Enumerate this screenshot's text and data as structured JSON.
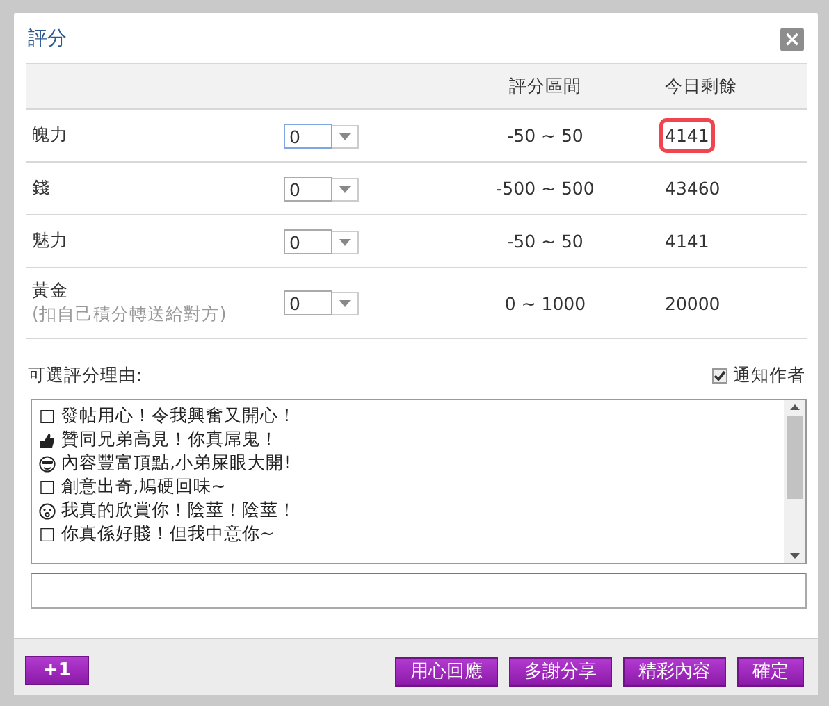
{
  "dialog": {
    "title": "評分",
    "close": "×"
  },
  "table": {
    "columns": [
      "",
      "",
      "評分區間",
      "今日剩餘"
    ],
    "rows": [
      {
        "name": "魄力",
        "note": "",
        "value": "0",
        "focused": true,
        "range": "-50 ~ 50",
        "remaining": "4141",
        "highlighted": true
      },
      {
        "name": "錢",
        "note": "",
        "value": "0",
        "focused": false,
        "range": "-500 ~ 500",
        "remaining": "43460",
        "highlighted": false
      },
      {
        "name": "魅力",
        "note": "",
        "value": "0",
        "focused": false,
        "range": "-50 ~ 50",
        "remaining": "4141",
        "highlighted": false
      },
      {
        "name": "黃金",
        "note": "(扣自己積分轉送給對方)",
        "value": "0",
        "focused": false,
        "range": "0 ~ 1000",
        "remaining": "20000",
        "highlighted": false
      }
    ]
  },
  "reasons": {
    "label": "可選評分理由:",
    "notify": {
      "label": "通知作者",
      "checked": true
    },
    "items": [
      {
        "kind": "plain",
        "text": "□ 發帖用心！令我興奮又開心！"
      },
      {
        "kind": "thumb",
        "text": "贊同兄弟高見！你真屌鬼！"
      },
      {
        "kind": "cool",
        "text": "內容豐富頂點,小弟屎眼大開!"
      },
      {
        "kind": "plain",
        "text": "□ 創意出奇,鳩硬回味~"
      },
      {
        "kind": "wow",
        "text": "我真的欣賞你！陰莖！陰莖！"
      },
      {
        "kind": "plain",
        "text": "□ 你真係好賤！但我中意你~"
      }
    ]
  },
  "footer": {
    "left_button": "+1",
    "buttons": [
      "用心回應",
      "多謝分享",
      "精彩內容",
      "確定"
    ]
  }
}
